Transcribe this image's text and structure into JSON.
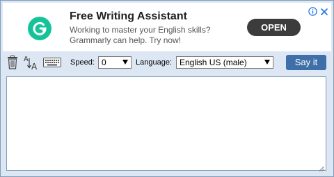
{
  "ad": {
    "title": "Free Writing Assistant",
    "body_line1": "Working to master your English skills?",
    "body_line2": "Grammarly can help. Try now!",
    "cta_label": "OPEN",
    "logo_icon": "grammarly-logo-icon",
    "info_icon": "info-icon",
    "close_icon": "close-icon",
    "brand_color": "#15c39a",
    "accent_color": "#1a73e8"
  },
  "toolbar": {
    "clear_icon": "trash-icon",
    "sort_icon": "sort-az-icon",
    "keyboard_icon": "keyboard-icon",
    "speed_label": "Speed:",
    "speed_value": "0",
    "language_label": "Language:",
    "language_value": "English US (male)",
    "say_label": "Say it",
    "button_color": "#3f6fa8"
  },
  "editor": {
    "value": ""
  }
}
